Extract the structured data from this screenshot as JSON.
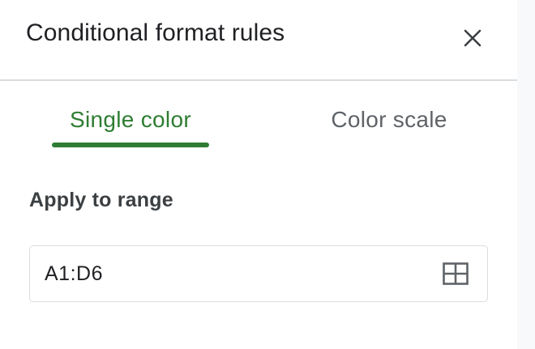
{
  "header": {
    "title": "Conditional format rules",
    "close_icon": "close-icon"
  },
  "tabs": [
    {
      "label": "Single color",
      "selected": true
    },
    {
      "label": "Color scale",
      "selected": false
    }
  ],
  "range": {
    "label": "Apply to range",
    "value": "A1:D6",
    "icon": "grid-select-icon"
  },
  "colors": {
    "accent": "#2e7d32",
    "text": "#202124",
    "muted": "#5f6368",
    "border": "#dadce0"
  }
}
